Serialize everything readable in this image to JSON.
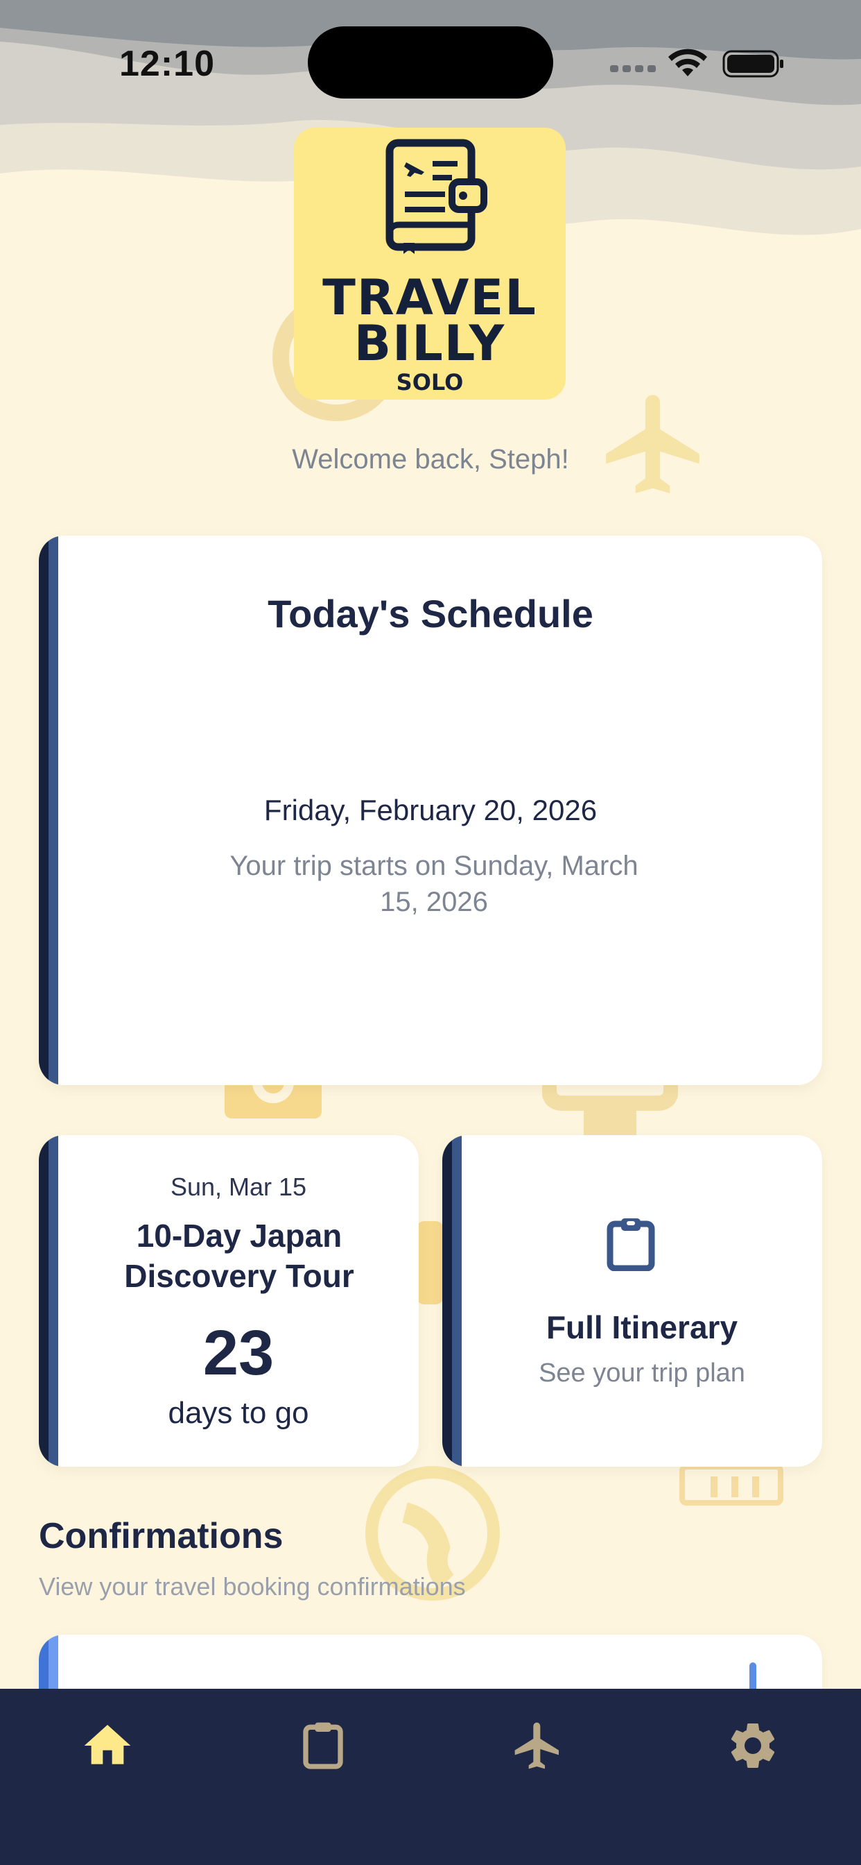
{
  "status_bar": {
    "time": "12:10"
  },
  "logo": {
    "line1": "TRAVEL",
    "line2": "BILLY",
    "line3": "SOLO"
  },
  "welcome": "Welcome back, Steph!",
  "schedule": {
    "title": "Today's Schedule",
    "date": "Friday, February 20, 2026",
    "subtitle": "Your trip starts on Sunday, March 15, 2026"
  },
  "trip": {
    "date": "Sun, Mar 15",
    "name": "10-Day Japan Discovery Tour",
    "count": "23",
    "count_label": "days to go"
  },
  "itinerary": {
    "title": "Full Itinerary",
    "subtitle": "See your trip plan"
  },
  "confirmations": {
    "title": "Confirmations",
    "subtitle": "View your travel booking confirmations"
  },
  "tabbar": {
    "items": [
      {
        "icon": "home-icon",
        "active": true
      },
      {
        "icon": "clipboard-icon",
        "active": false
      },
      {
        "icon": "airplane-icon",
        "active": false
      },
      {
        "icon": "gear-icon",
        "active": false
      }
    ]
  },
  "colors": {
    "background": "#fdf5de",
    "navy": "#1e2745",
    "accent_yellow": "#fde98a",
    "tab_active": "#fde98a",
    "tab_inactive": "#b9a888",
    "muted_text": "#7d8492"
  }
}
